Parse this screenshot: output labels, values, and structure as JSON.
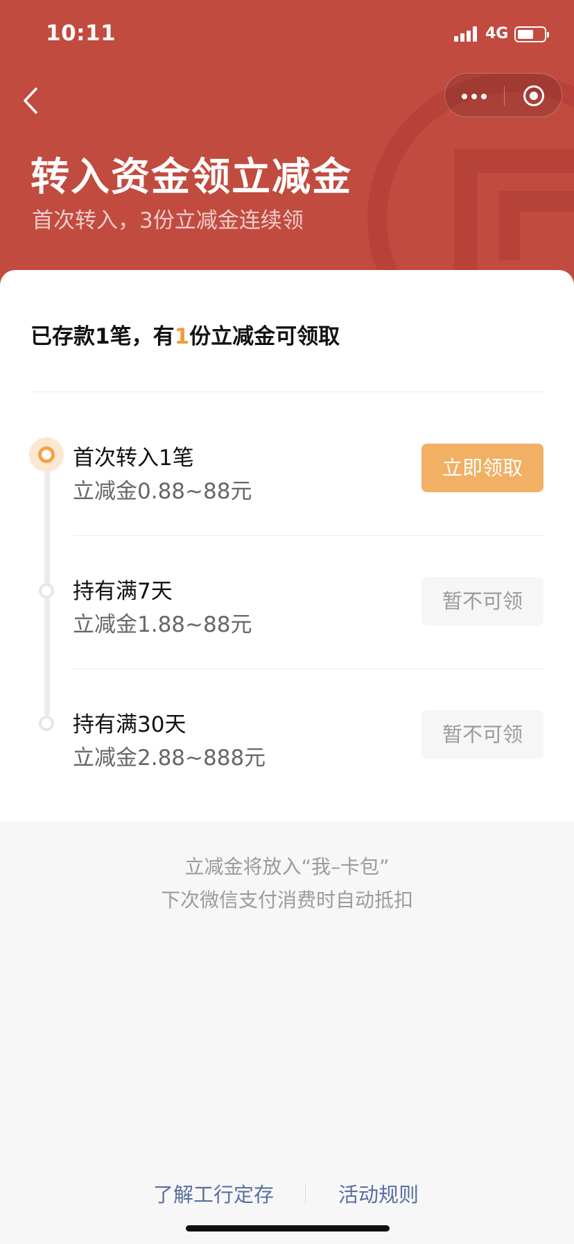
{
  "status_bar": {
    "time": "10:11",
    "network": "4G"
  },
  "header": {
    "title": "转入资金领立减金",
    "subtitle": "首次转入，3份立减金连续领",
    "bg_color": "#c24b40"
  },
  "summary": {
    "prefix": "已存款1笔，有",
    "count": "1",
    "suffix": "份立减金可领取"
  },
  "steps": [
    {
      "title": "首次转入1笔",
      "desc": "立减金0.88~88元",
      "button": "立即领取",
      "state": "active"
    },
    {
      "title": "持有满7天",
      "desc": "立减金1.88~88元",
      "button": "暂不可领",
      "state": "disabled"
    },
    {
      "title": "持有满30天",
      "desc": "立减金2.88~888元",
      "button": "暂不可领",
      "state": "disabled"
    }
  ],
  "note": {
    "line1": "立减金将放入“我–卡包”",
    "line2": "下次微信支付消费时自动抵扣"
  },
  "bottom_links": {
    "left": "了解工行定存",
    "right": "活动规则"
  },
  "colors": {
    "accent": "#f1b063",
    "highlight": "#f29b3c",
    "link": "#5a6fa0"
  }
}
